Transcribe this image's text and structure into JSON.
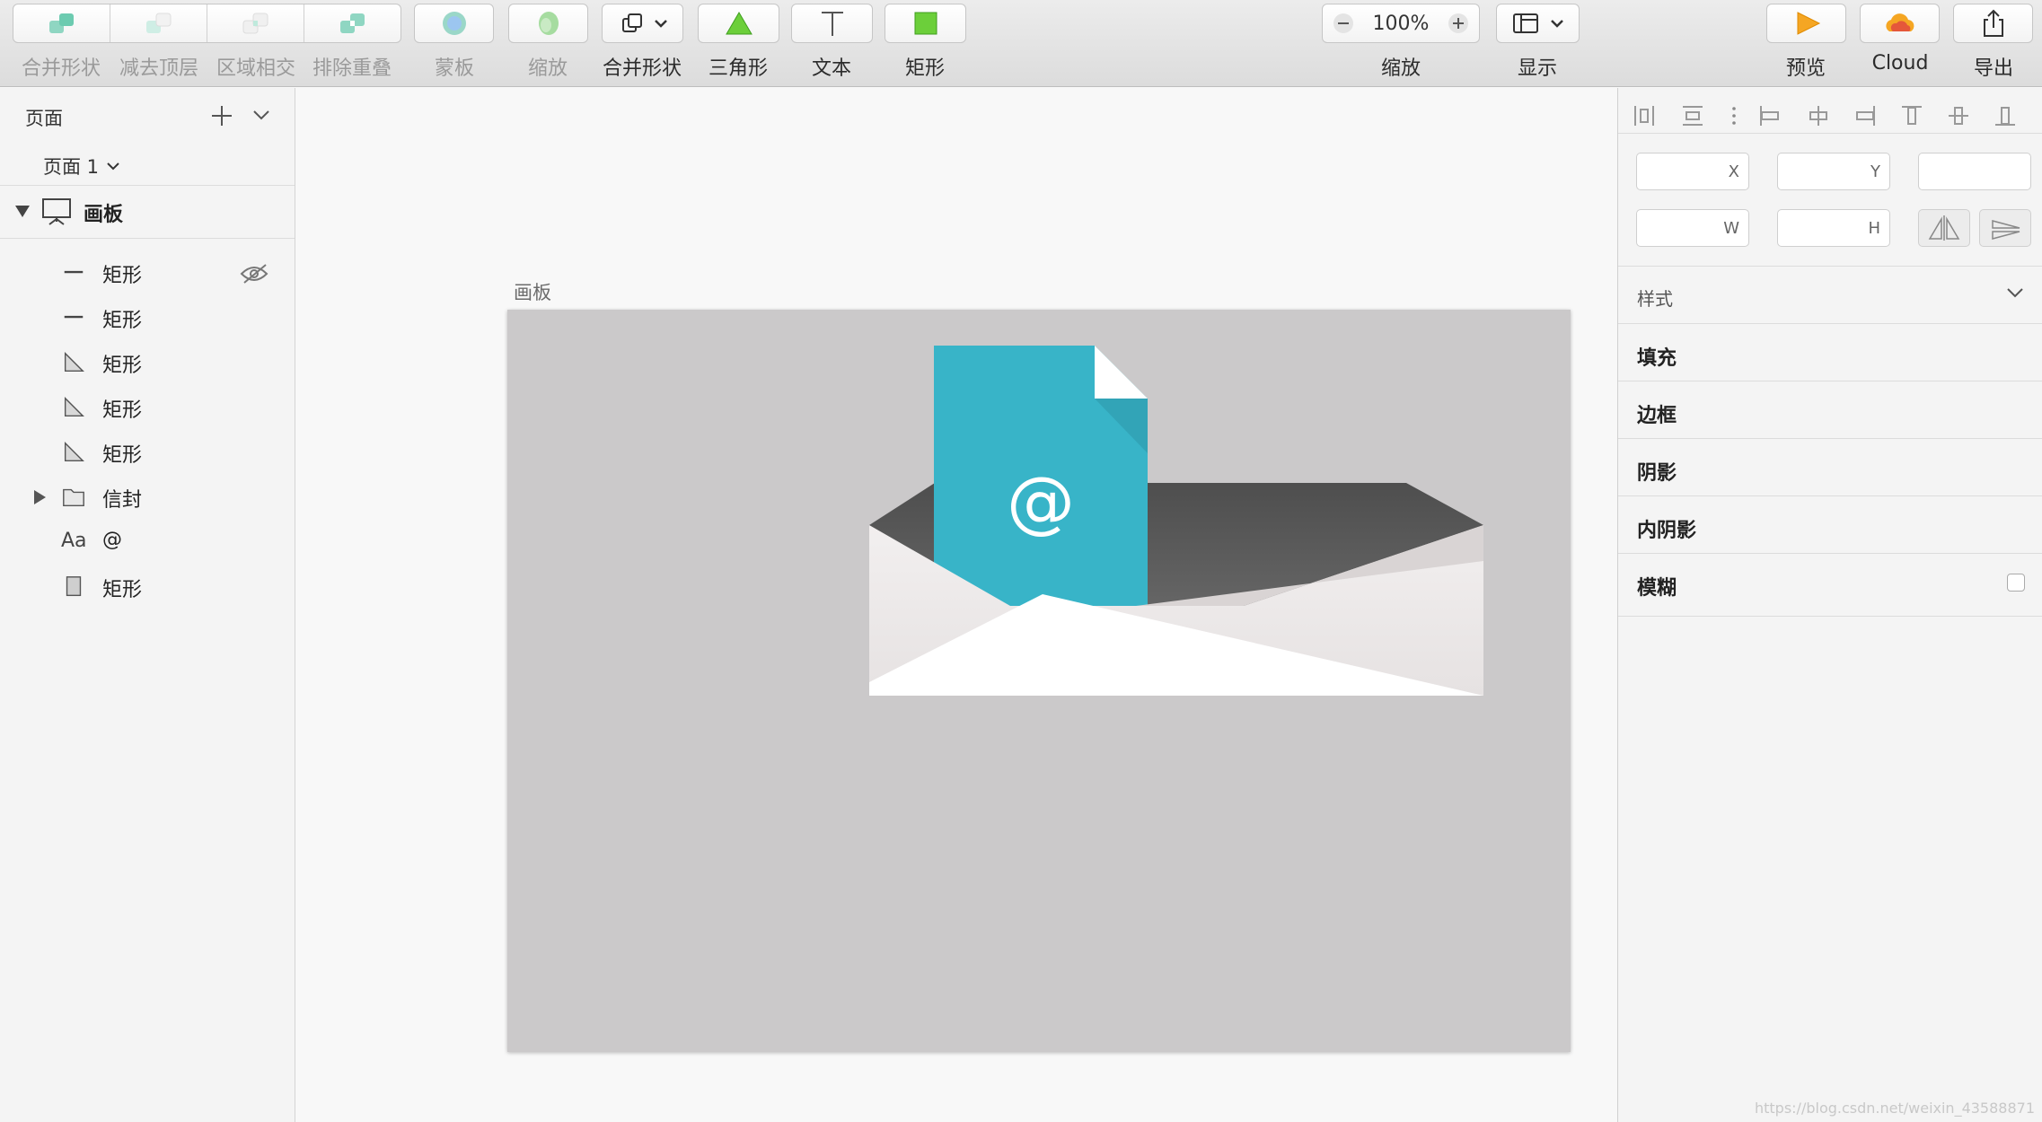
{
  "toolbar": {
    "boolean_ops": [
      "合并形状",
      "减去顶层",
      "区域相交",
      "排除重叠"
    ],
    "mask": "蒙板",
    "scale": "缩放",
    "combine": "合并形状",
    "triangle": "三角形",
    "text": "文本",
    "rectangle": "矩形",
    "zoom_value": "100%",
    "zoom_label": "缩放",
    "display": "显示",
    "preview": "预览",
    "cloud": "Cloud",
    "export": "导出"
  },
  "pages": {
    "title": "页面",
    "current": "页面 1"
  },
  "layers": {
    "artboard": "画板",
    "items": [
      {
        "icon": "line-icon",
        "name": "矩形",
        "hidden": true
      },
      {
        "icon": "line-icon",
        "name": "矩形"
      },
      {
        "icon": "triangle-icon",
        "name": "矩形"
      },
      {
        "icon": "triangle-icon",
        "name": "矩形"
      },
      {
        "icon": "triangle-icon",
        "name": "矩形"
      },
      {
        "icon": "folder-icon",
        "name": "信封"
      },
      {
        "icon": "text-icon",
        "name": "@",
        "icon_text": "Aa"
      },
      {
        "icon": "rect-icon",
        "name": "矩形"
      }
    ]
  },
  "canvas": {
    "artboard_title": "画板",
    "at_symbol": "@",
    "colors": {
      "paper": "#38b4c8",
      "envelope": "#ece8e8",
      "flap_inside": "#5e5e5e",
      "board": "#cbc9ca"
    }
  },
  "inspector": {
    "x_label": "X",
    "y_label": "Y",
    "w_label": "W",
    "h_label": "H",
    "style": "样式",
    "sections": [
      "填充",
      "边框",
      "阴影",
      "内阴影",
      "模糊"
    ]
  },
  "watermark": "https://blog.csdn.net/weixin_43588871"
}
